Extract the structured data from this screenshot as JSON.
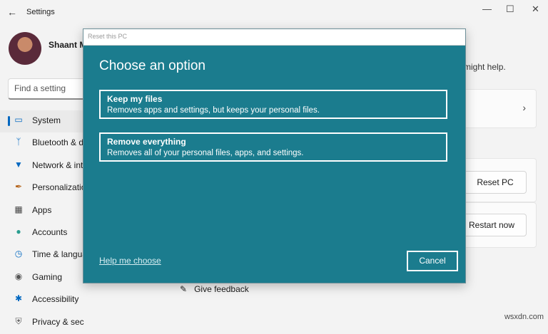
{
  "window": {
    "back_icon": "back-arrow-icon",
    "title": "Settings",
    "minimize": "—",
    "maximize": "☐",
    "close": "✕"
  },
  "profile": {
    "name": "Shaant M"
  },
  "search": {
    "placeholder": "Find a setting"
  },
  "sidebar": {
    "items": [
      {
        "label": "System",
        "icon": "monitor-icon",
        "active": true
      },
      {
        "label": "Bluetooth & devices",
        "icon": "bluetooth-icon"
      },
      {
        "label": "Network & internet",
        "icon": "wifi-icon"
      },
      {
        "label": "Personalization",
        "icon": "brush-icon"
      },
      {
        "label": "Apps",
        "icon": "apps-icon"
      },
      {
        "label": "Accounts",
        "icon": "person-icon"
      },
      {
        "label": "Time & language",
        "icon": "globe-clock-icon"
      },
      {
        "label": "Gaming",
        "icon": "gamepad-icon"
      },
      {
        "label": "Accessibility",
        "icon": "accessibility-icon"
      },
      {
        "label": "Privacy & security",
        "icon": "shield-icon"
      }
    ]
  },
  "background": {
    "hint_text": "might help.",
    "reset_button": "Reset PC",
    "restart_button": "Restart now",
    "give_feedback": "Give feedback"
  },
  "dialog": {
    "title": "Reset this PC",
    "heading": "Choose an option",
    "options": [
      {
        "title": "Keep my files",
        "description": "Removes apps and settings, but keeps your personal files."
      },
      {
        "title": "Remove everything",
        "description": "Removes all of your personal files, apps, and settings."
      }
    ],
    "help_link": "Help me choose",
    "cancel_label": "Cancel"
  },
  "watermark": "wsxdn.com",
  "colors": {
    "dialog_bg": "#1b7c8e",
    "accent": "#0067c0",
    "window_bg": "#f3f3f3"
  }
}
